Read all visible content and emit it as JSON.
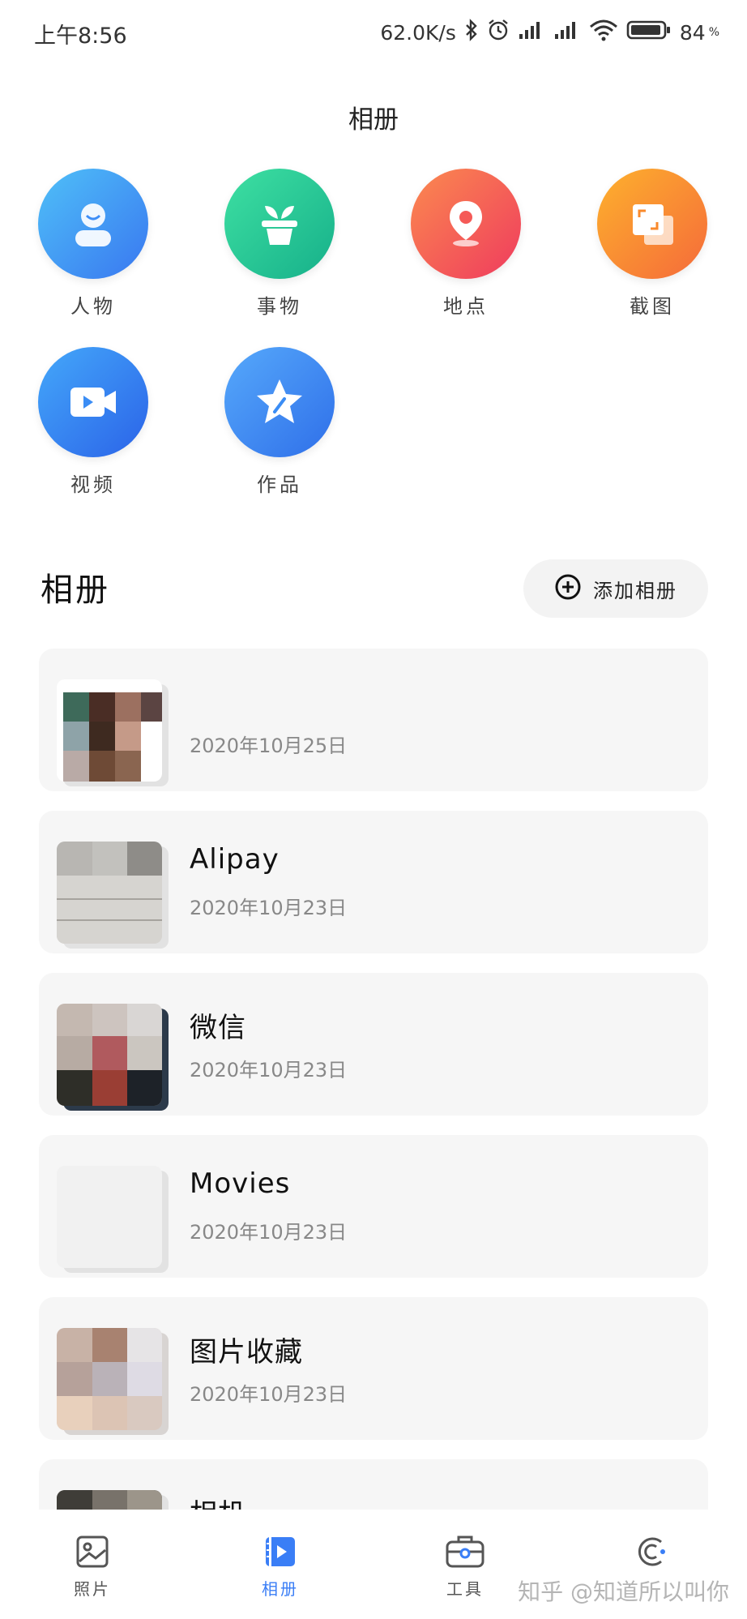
{
  "status_bar": {
    "time": "上午8:56",
    "network_speed": "62.0K/s",
    "battery": "84",
    "battery_unit": "%"
  },
  "header": {
    "title": "相册"
  },
  "categories": [
    {
      "label": "人物",
      "icon": "person-icon",
      "color": "#3d8ef7"
    },
    {
      "label": "事物",
      "icon": "plant-pot-icon",
      "color": "#22c98c"
    },
    {
      "label": "地点",
      "icon": "location-pin-icon",
      "color": "#f55a57"
    },
    {
      "label": "截图",
      "icon": "screenshot-icon",
      "color": "#f98a2c"
    },
    {
      "label": "视频",
      "icon": "video-icon",
      "color": "#2f7ef0"
    },
    {
      "label": "作品",
      "icon": "star-brush-icon",
      "color": "#3b8df5"
    }
  ],
  "albums_section": {
    "title": "相册",
    "add_label": "添加相册"
  },
  "albums": [
    {
      "name": "",
      "date": "2020年10月25日"
    },
    {
      "name": "Alipay",
      "date": "2020年10月23日"
    },
    {
      "name": "微信",
      "date": "2020年10月23日"
    },
    {
      "name": "Movies",
      "date": "2020年10月23日"
    },
    {
      "name": "图片收藏",
      "date": "2020年10月23日"
    },
    {
      "name": "相机",
      "date": ""
    }
  ],
  "bottom_nav": {
    "items": [
      {
        "label": "照片",
        "icon": "photo-icon"
      },
      {
        "label": "相册",
        "icon": "album-icon",
        "active": true
      },
      {
        "label": "工具",
        "icon": "toolbox-icon"
      },
      {
        "label": "",
        "icon": "creative-icon"
      }
    ],
    "watermark": "知乎 @知道所以叫你"
  }
}
